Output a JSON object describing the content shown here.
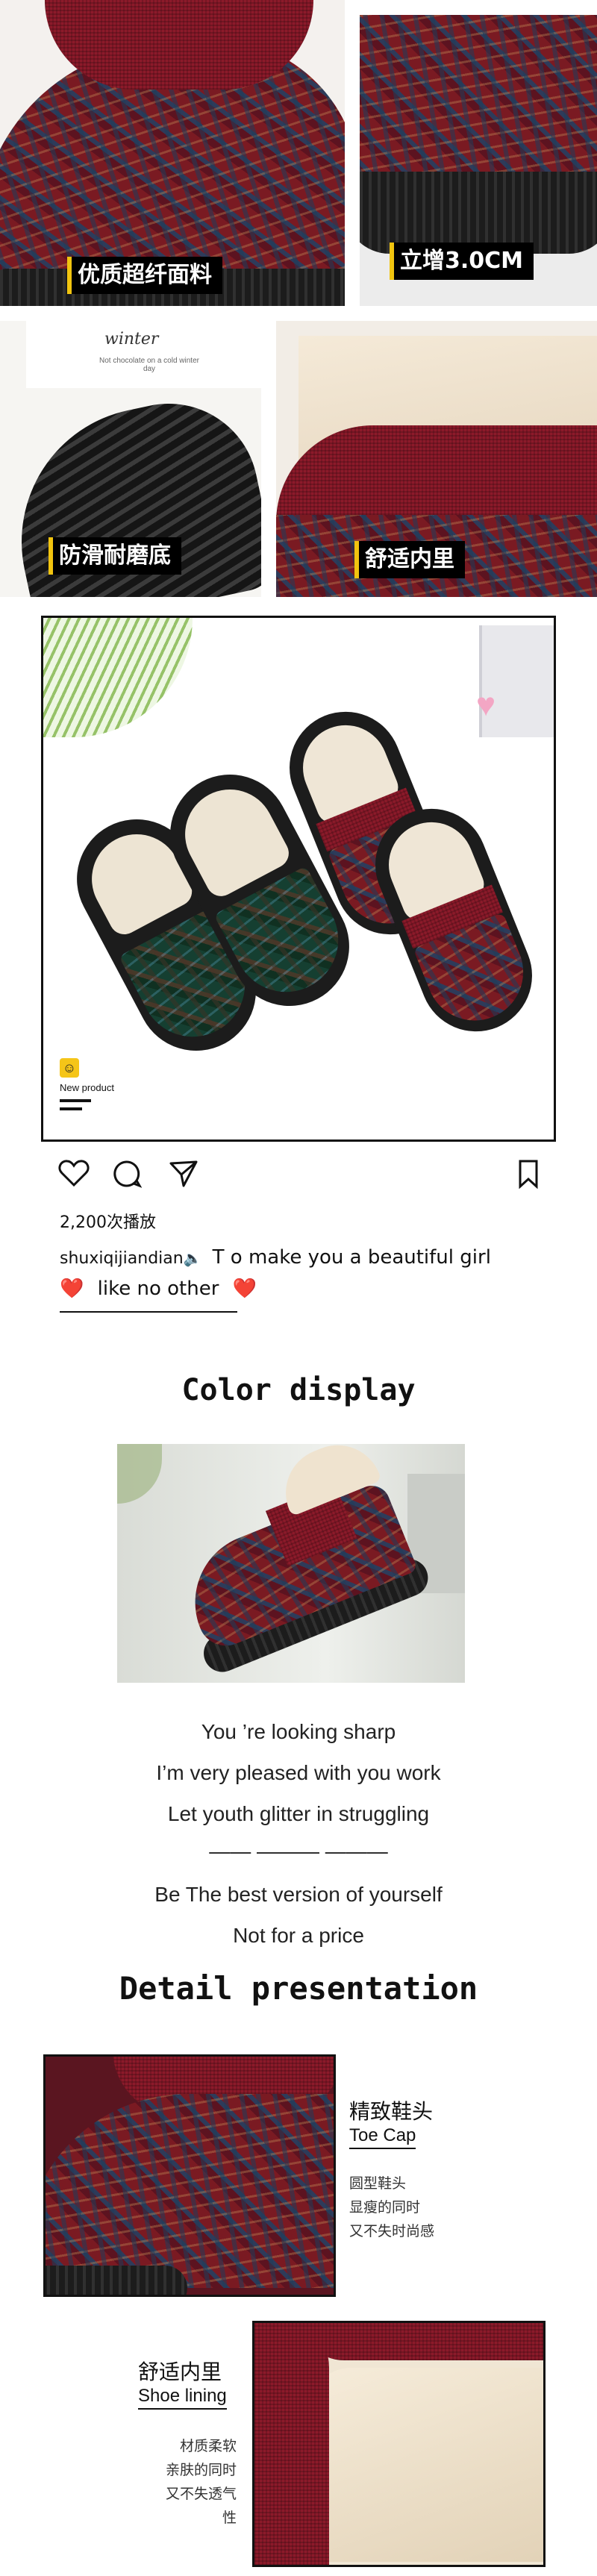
{
  "features": {
    "fabric_label": "优质超纤面料",
    "height_label": "立增3.0CM",
    "sole_label": "防滑耐磨底",
    "lining_label": "舒适内里",
    "card_title": "winter",
    "card_text": "Not chocolate on a cold winter day"
  },
  "instagram": {
    "new_product": "New product",
    "views": "2,200次播放",
    "username": "shuxiqijiandian",
    "caption_line1": "T o make you a beautiful girl",
    "caption_line2": "like no other",
    "heart_emoji": "❤️",
    "icons": [
      "heart-icon",
      "comment-icon",
      "send-icon",
      "bookmark-icon"
    ]
  },
  "color_display": {
    "title": "Color display",
    "lines": [
      "You ’re looking sharp",
      "I’m very pleased with you work",
      "Let youth glitter in struggling",
      "—— ——— ———",
      "Be The best version of yourself",
      "Not for a price"
    ]
  },
  "detail": {
    "title": "Detail presentation",
    "toe_cap": {
      "title": "精致鞋头",
      "subtitle": "Toe Cap",
      "desc": [
        "圆型鞋头",
        "显瘦的同时",
        "又不失时尚感"
      ]
    },
    "shoe_lining": {
      "title": "舒适内里",
      "subtitle": "Shoe lining",
      "desc": [
        "材质柔软",
        "亲肤的同时",
        "又不失透气性"
      ]
    }
  },
  "colors": {
    "wine_red": "#8c1a2a",
    "navy": "#2e3b5a",
    "black": "#111111",
    "accent_yellow": "#f1c40f"
  }
}
